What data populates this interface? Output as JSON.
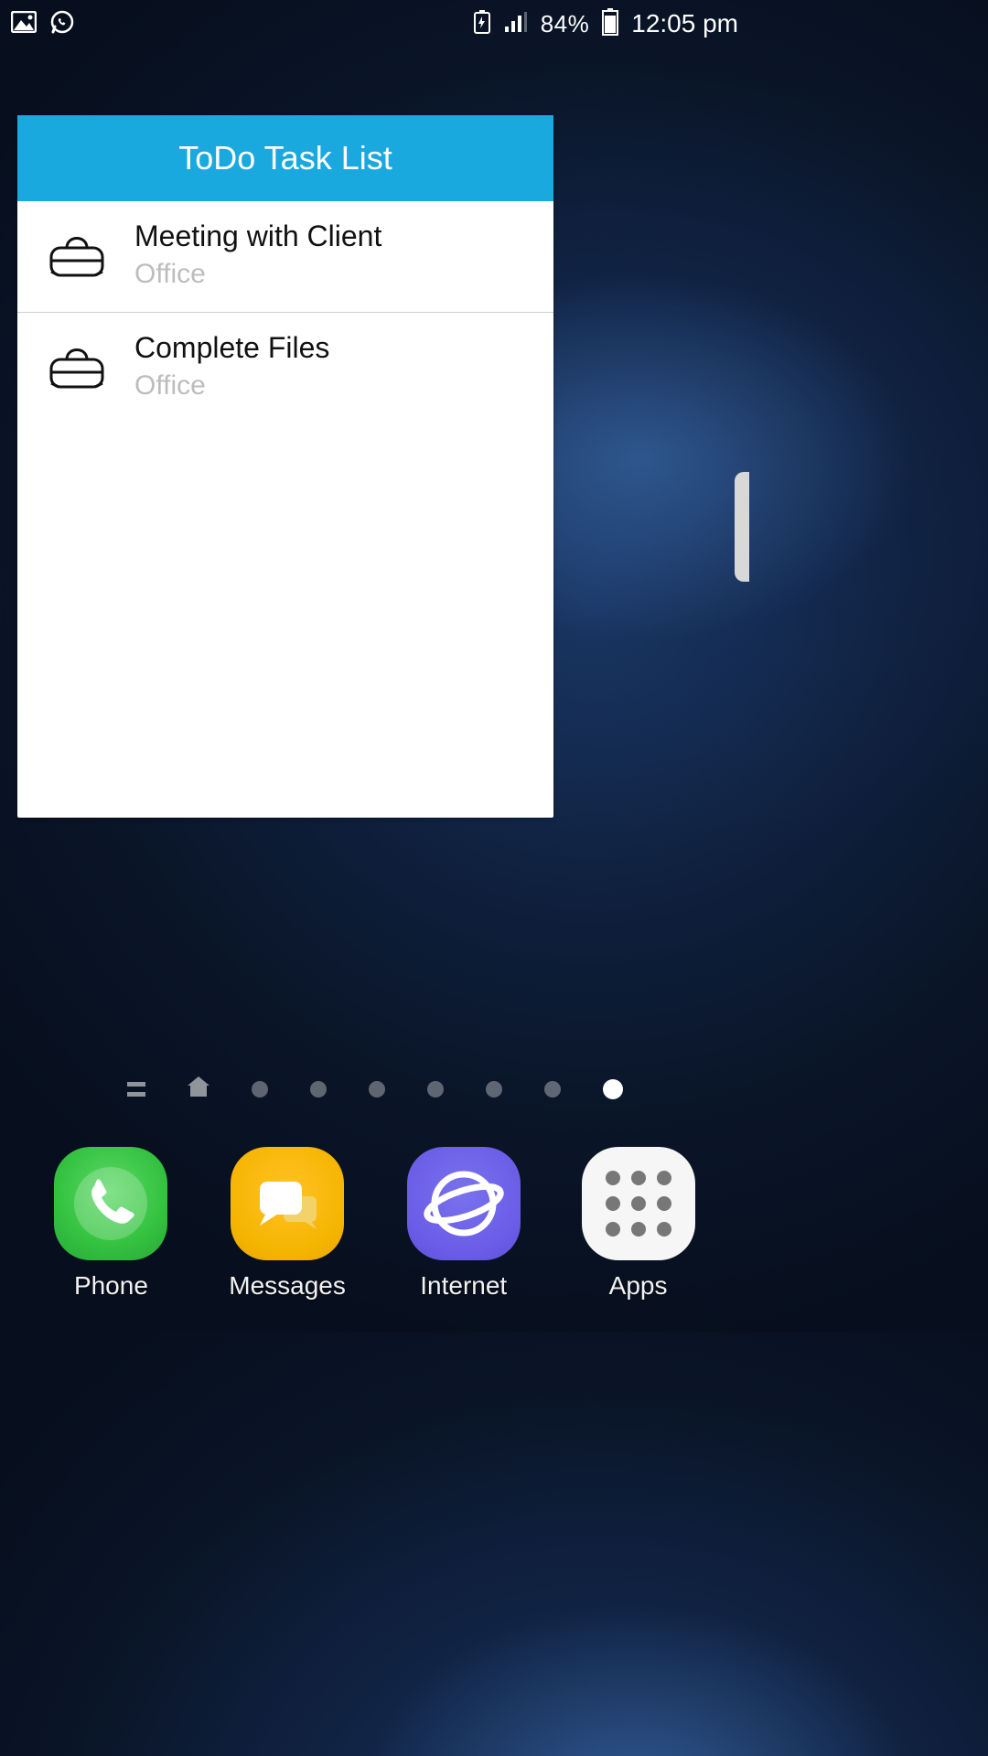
{
  "status": {
    "battery_percent": "84%",
    "time": "12:05 pm"
  },
  "widget": {
    "title": "ToDo Task List",
    "tasks": [
      {
        "title": "Meeting with Client",
        "subtitle": "Office"
      },
      {
        "title": "Complete Files",
        "subtitle": "Office"
      }
    ]
  },
  "dock": {
    "items": [
      {
        "label": "Phone"
      },
      {
        "label": "Messages"
      },
      {
        "label": "Internet"
      },
      {
        "label": "Apps"
      }
    ]
  }
}
